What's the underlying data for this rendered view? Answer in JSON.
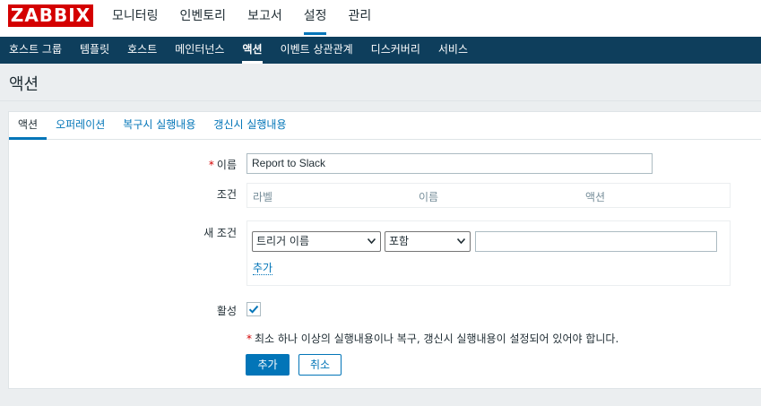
{
  "logo": "ZABBIX",
  "main_menu": [
    "모니터링",
    "인벤토리",
    "보고서",
    "설정",
    "관리"
  ],
  "sub_menu": [
    "호스트 그룹",
    "템플릿",
    "호스트",
    "메인터넌스",
    "액션",
    "이벤트 상관관계",
    "디스커버리",
    "서비스"
  ],
  "page_title": "액션",
  "tabs": [
    "액션",
    "오퍼레이션",
    "복구시 실행내용",
    "갱신시 실행내용"
  ],
  "form": {
    "name_label": "이름",
    "name_value": "Report to Slack",
    "conditions_label": "조건",
    "conditions_headers": [
      "라벨",
      "이름",
      "액션"
    ],
    "new_condition_label": "새 조건",
    "condition_type": "트리거 이름",
    "condition_operator": "포함",
    "condition_value": "",
    "add_link": "추가",
    "enabled_label": "활성",
    "enabled": true,
    "note": "최소 하나 이상의 실행내용이나 복구, 갱신시 실행내용이 설정되어 있어야 합니다.",
    "add_button": "추가",
    "cancel_button": "취소"
  },
  "colors": {
    "brand": "#d40000",
    "accent": "#0275b8",
    "subnav_bg": "#0e3e5c"
  }
}
